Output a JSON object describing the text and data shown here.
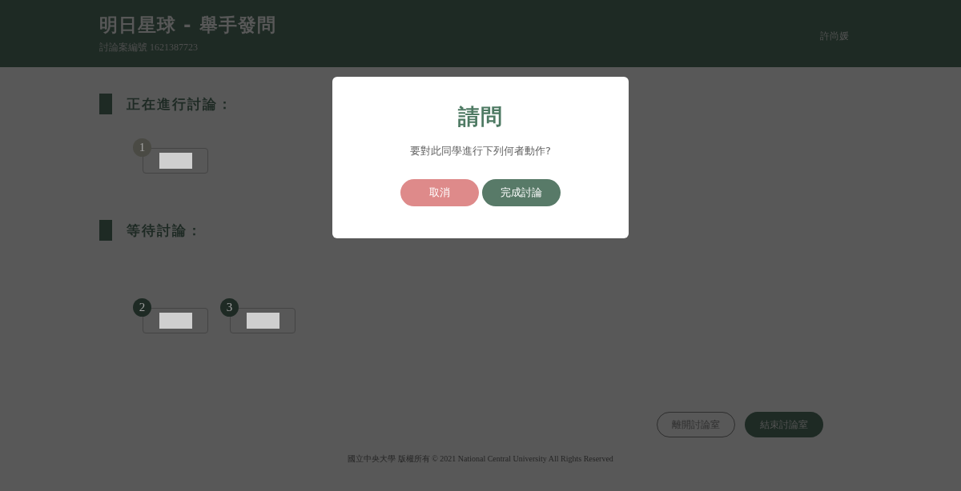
{
  "header": {
    "title": "明日星球 - 舉手發問",
    "room_id": "討論案編號 1621387723",
    "user": "許尚媛"
  },
  "sections": [
    {
      "heading": "正在進行討論：",
      "students": [
        {
          "number": "1",
          "active": true
        }
      ]
    },
    {
      "heading": "等待討論：",
      "students": [
        {
          "number": "2",
          "active": false
        },
        {
          "number": "3",
          "active": false
        }
      ]
    }
  ],
  "actions": [
    {
      "label": "離開討論室",
      "kind": "outline"
    },
    {
      "label": "結束討論室",
      "kind": "filled"
    }
  ],
  "footer": "國立中央大學 版權所有 © 2021 National Central University All Rights Reserved",
  "dialog": {
    "title": "請問",
    "message": "要對此同學進行下列何者動作?",
    "buttons": [
      {
        "label": "取消",
        "kind": "cancel"
      },
      {
        "label": "完成討論",
        "kind": "confirm"
      }
    ]
  }
}
